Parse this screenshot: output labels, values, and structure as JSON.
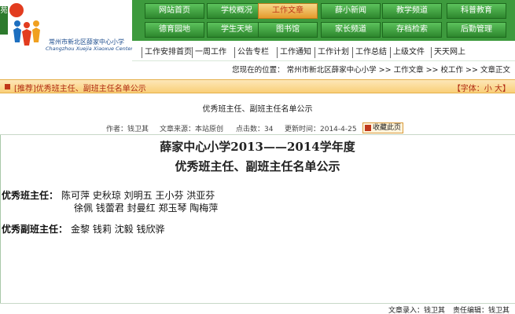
{
  "logo": {
    "badge": "苑",
    "name": "常州市新北区薛家中心小学",
    "en": "Changzhou Xuejia Xiaoxue Center School"
  },
  "nav": {
    "row1": [
      "网站首页",
      "学校概况",
      "工作文章",
      "薛小新闻",
      "教学频道",
      "科普教育"
    ],
    "row2": [
      "德育园地",
      "学生天地",
      "图书馆",
      "家长频道",
      "存档检索",
      "后勤管理"
    ],
    "active_index": 2
  },
  "subnav": [
    "工作安排首页",
    "一周工作",
    "公告专栏",
    "工作通知",
    "工作计划",
    "工作总结",
    "上级文件",
    "天天网上"
  ],
  "breadcrumb": "您现在的位置： 常州市新北区薛家中心小学 >> 工作文章 >> 校工作 >> 文章正文",
  "notice": {
    "title": "[推荐]优秀班主任、副班主任名单公示",
    "font": "【字体：小 大】"
  },
  "article": {
    "title": "优秀班主任、副班主任名单公示",
    "meta": {
      "author": "作者：钱卫其",
      "source": "文章来源：本站原创",
      "hits": "点击数：34",
      "updated": "更新时间：2014-4-25"
    },
    "fav": "收藏此页",
    "heading1": "薛家中心小学2013——2014学年度",
    "heading2": "优秀班主任、副班主任名单公示",
    "best_label": "优秀班主任：",
    "best_line1": "陈可萍  史秋琼  刘明五  王小芬  洪亚芬",
    "best_line2": "徐佩  钱蕾君  封曼红  郑玉琴  陶梅萍",
    "vice_label": "优秀副班主任：",
    "vice_line": "金黎  钱莉  沈毅  钱欣骅"
  },
  "footer": {
    "entry": "文章录入：钱卫其",
    "editor": "责任编辑：钱卫其"
  }
}
